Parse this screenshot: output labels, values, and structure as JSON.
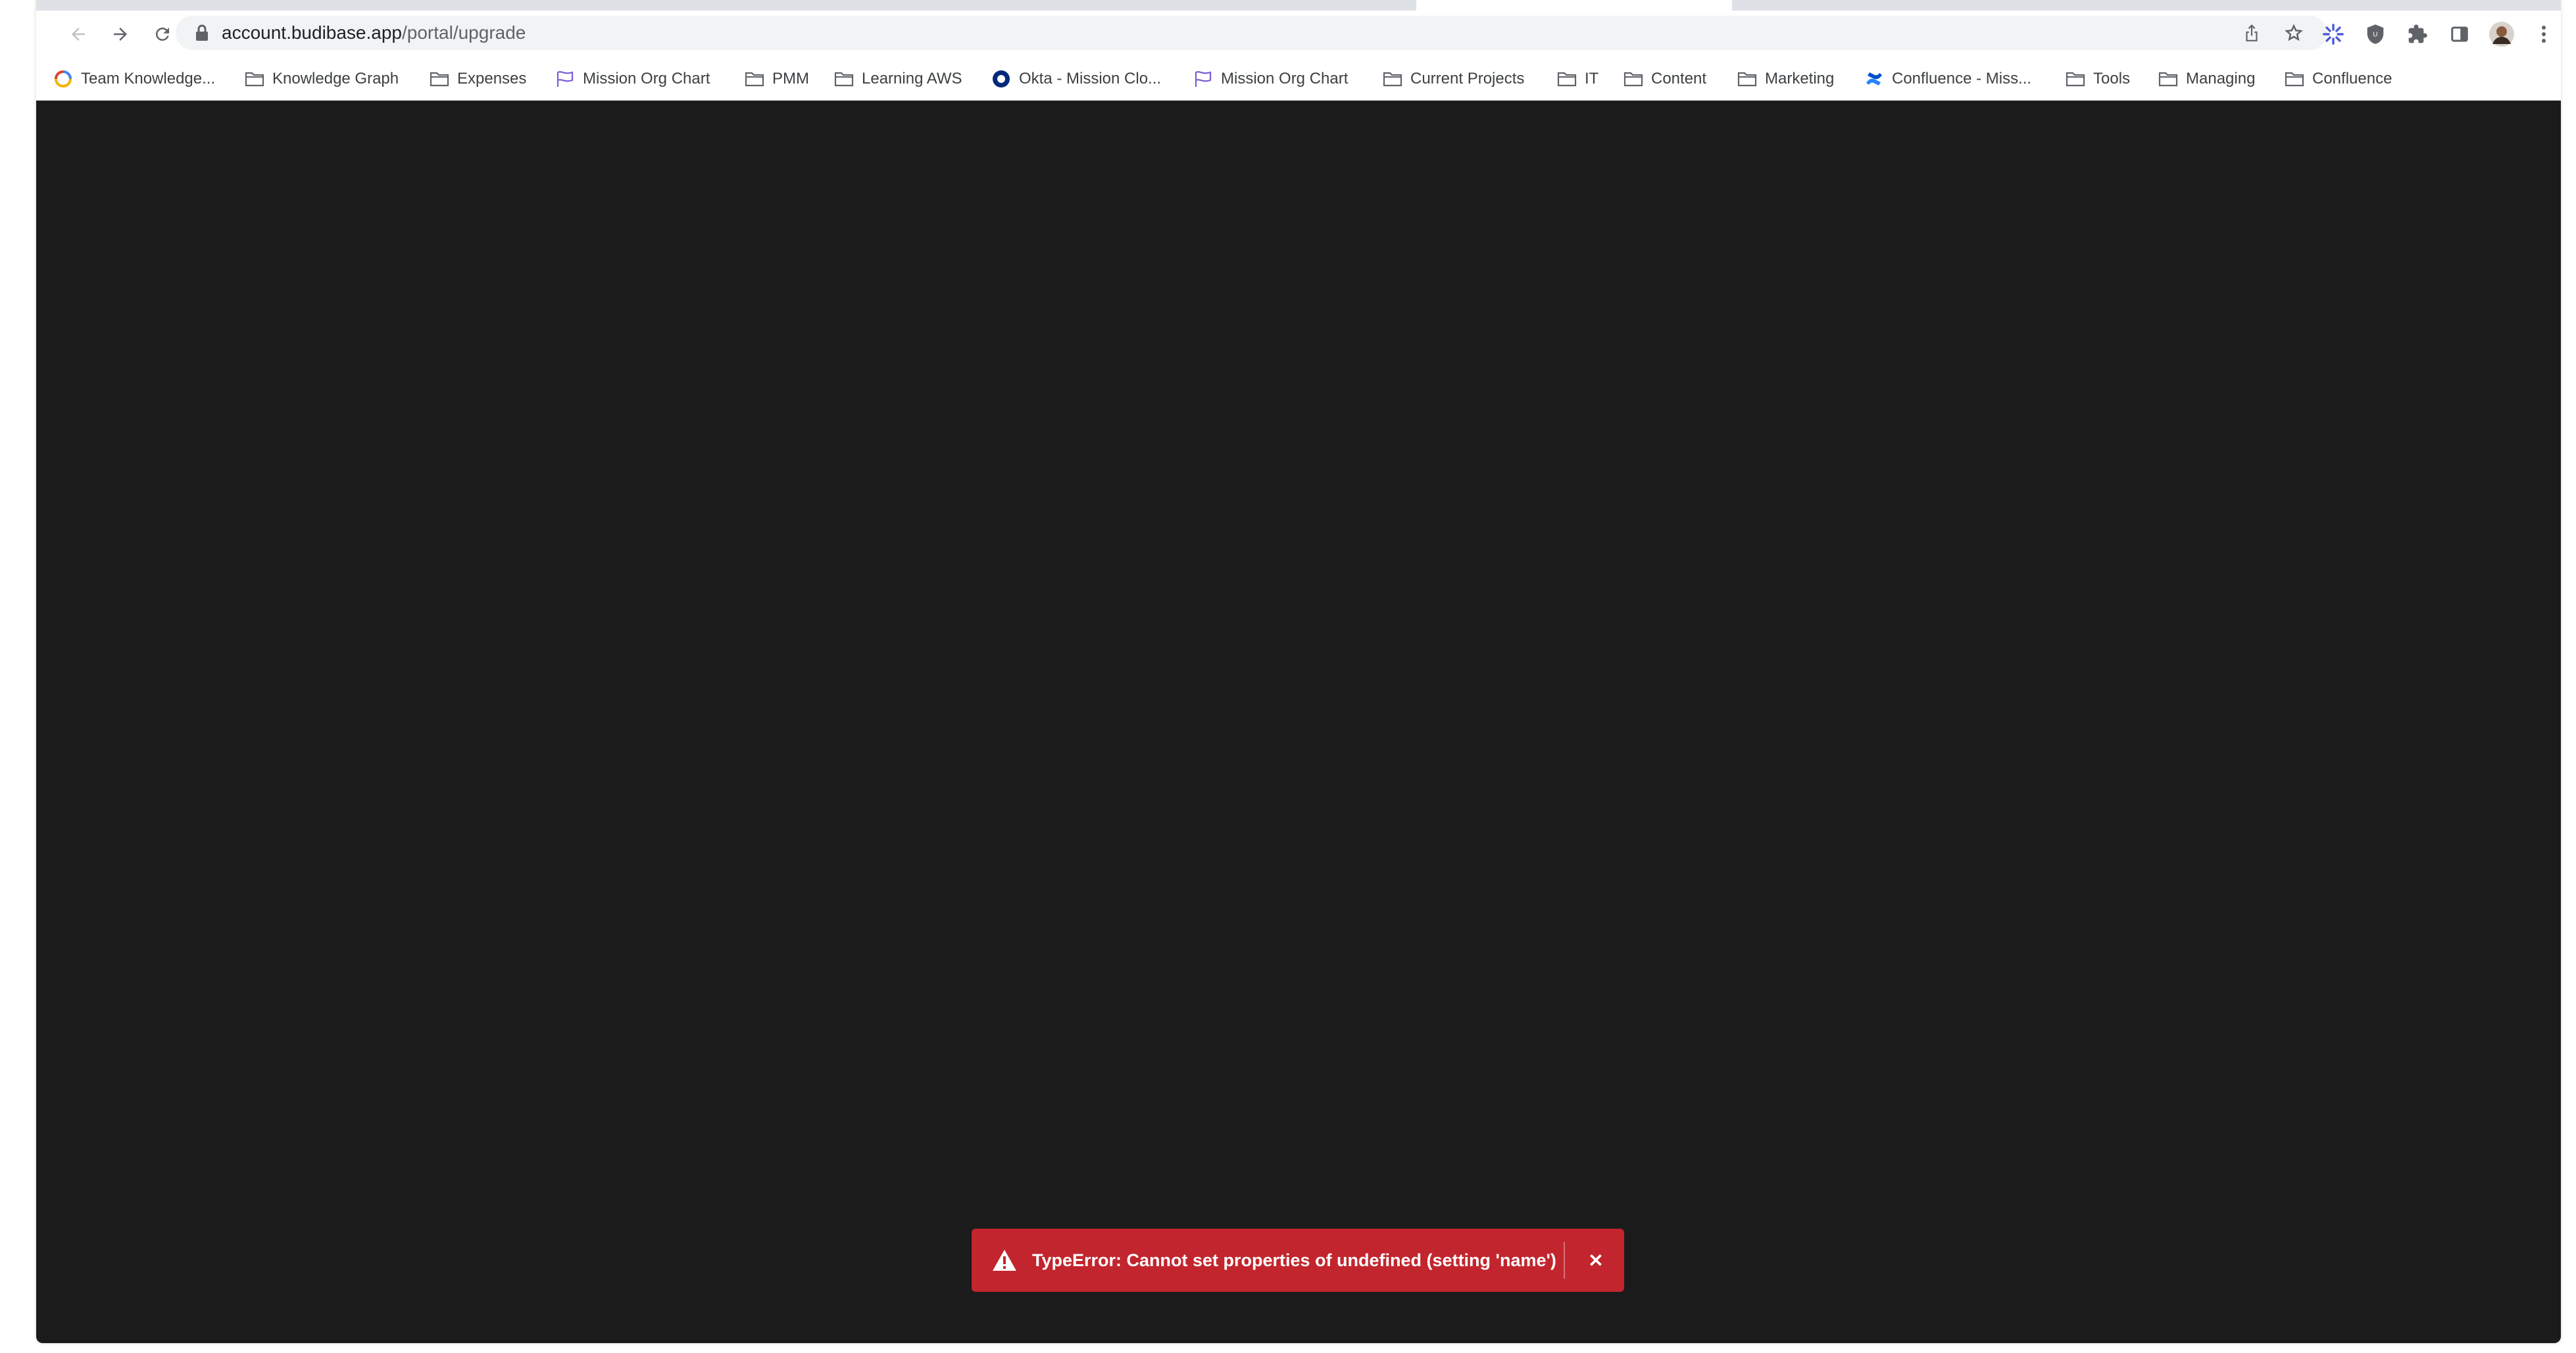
{
  "browser": {
    "url_host": "account.budibase.app",
    "url_path": "/portal/upgrade",
    "icons": {
      "back": "back-arrow-icon",
      "forward": "forward-arrow-icon",
      "reload": "reload-icon",
      "lock": "lock-icon",
      "share": "share-icon",
      "bookmark_star": "star-icon",
      "extensions": "puzzle-icon",
      "side_panel": "side-panel-icon",
      "profile": "profile-avatar",
      "menu": "kebab-menu-icon"
    }
  },
  "bookmarks": [
    {
      "label": "Team Knowledge...",
      "icon": "circle-logo-icon"
    },
    {
      "label": "Knowledge Graph",
      "icon": "folder-icon"
    },
    {
      "label": "Expenses",
      "icon": "folder-icon"
    },
    {
      "label": "Mission Org Chart",
      "icon": "flag-icon"
    },
    {
      "label": "PMM",
      "icon": "folder-icon"
    },
    {
      "label": "Learning AWS",
      "icon": "folder-icon"
    },
    {
      "label": "Okta - Mission Clo...",
      "icon": "okta-icon"
    },
    {
      "label": "Mission Org Chart",
      "icon": "flag-icon"
    },
    {
      "label": "Current Projects",
      "icon": "folder-icon"
    },
    {
      "label": "IT",
      "icon": "folder-icon"
    },
    {
      "label": "Content",
      "icon": "folder-icon"
    },
    {
      "label": "Marketing",
      "icon": "folder-icon"
    },
    {
      "label": "Confluence - Miss...",
      "icon": "confluence-icon"
    },
    {
      "label": "Tools",
      "icon": "folder-icon"
    },
    {
      "label": "Managing",
      "icon": "folder-icon"
    },
    {
      "label": "Confluence",
      "icon": "folder-icon"
    }
  ],
  "toast": {
    "message": "TypeError: Cannot set properties of undefined (setting 'name')",
    "close_label": "✕",
    "icon": "warning-triangle-icon"
  },
  "colors": {
    "content_bg": "#1b1b1b",
    "toast_bg": "#c2252d"
  }
}
